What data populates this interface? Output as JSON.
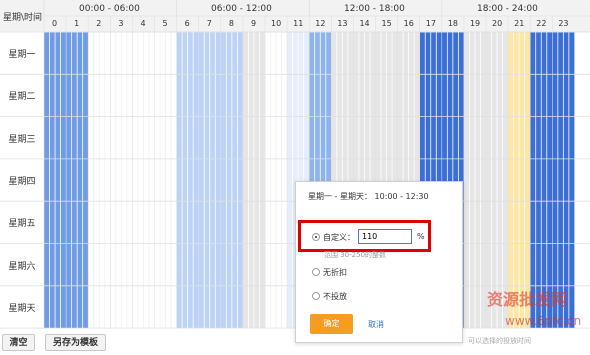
{
  "header": {
    "corner_label": "星期\\时间",
    "groups": [
      "00:00 - 06:00",
      "06:00 - 12:00",
      "12:00 - 18:00",
      "18:00 - 24:00"
    ],
    "hours": [
      "0",
      "1",
      "2",
      "3",
      "4",
      "5",
      "6",
      "7",
      "8",
      "9",
      "10",
      "11",
      "12",
      "13",
      "14",
      "15",
      "16",
      "17",
      "18",
      "19",
      "20",
      "21",
      "22",
      "23"
    ]
  },
  "days": [
    "星期一",
    "星期二",
    "星期三",
    "星期四",
    "星期五",
    "星期六",
    "星期天"
  ],
  "colors": {
    "header_bg": "#f2f2f2",
    "white": "#ffffff",
    "light_blue": "#bcd3f6",
    "mid_blue": "#8fb3ec",
    "blue": "#6f9ce4",
    "strong_blue": "#3b6fd6",
    "grey": "#e6e6e6",
    "pale_blue": "#e7eefb",
    "yellow": "#fde7a6",
    "line": "#e0e0e0"
  },
  "hour_colors": [
    "blue",
    "blue",
    "white",
    "white",
    "white",
    "white",
    "light_blue",
    "light_blue",
    "light_blue",
    "grey",
    "white",
    "pale_blue",
    "mid_blue",
    "grey",
    "grey",
    "grey",
    "grey",
    "strong_blue",
    "strong_blue",
    "grey",
    "grey",
    "yellow",
    "strong_blue",
    "strong_blue"
  ],
  "buttons": {
    "clear": "清空",
    "save_template": "另存为模板"
  },
  "popup": {
    "range_text": "星期一 - 星期天： 10:00 - 12:30",
    "options": [
      {
        "label": "自定义：",
        "checked": true
      },
      {
        "label": "无折扣",
        "checked": false
      },
      {
        "label": "不投放",
        "checked": false
      }
    ],
    "custom_value": "110",
    "unit": "%",
    "hint": "范围 30-250的整数",
    "ok_label": "确定",
    "cancel_label": "取消"
  },
  "watermark": {
    "main": "资源批发网",
    "domain": "www.6pfc.cn",
    "sub": "可以选择的投放时间"
  }
}
